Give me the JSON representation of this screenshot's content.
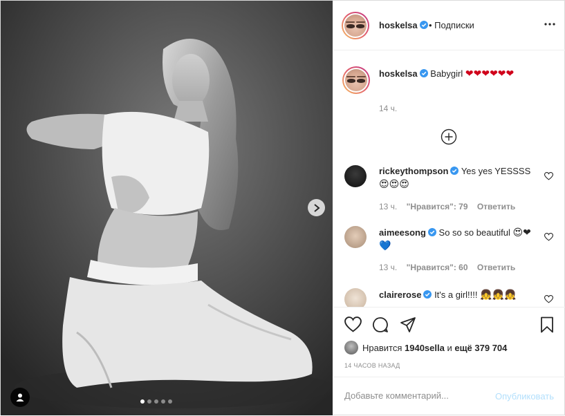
{
  "header": {
    "username": "hoskelsa",
    "follow_label": "• Подписки",
    "more_icon": "more-horizontal-icon"
  },
  "caption": {
    "username": "hoskelsa",
    "text": "Babygirl",
    "emojis": "❤❤❤❤❤❤",
    "time": "14 ч."
  },
  "comments": [
    {
      "username": "rickeythompson",
      "text": "Yes yes YESSSS",
      "emojis": "😍😍😍",
      "time": "13 ч.",
      "likes": "\"Нравится\": 79",
      "reply": "Ответить"
    },
    {
      "username": "aimeesong",
      "text": "So so so beautiful",
      "emojis": "😍❤💙",
      "time": "13 ч.",
      "likes": "\"Нравится\": 60",
      "reply": "Ответить"
    },
    {
      "username": "clairerose",
      "text": "It's a girl!!!!",
      "emojis": "👧👧👧"
    }
  ],
  "actions": {
    "liked_by_prefix": "Нравится",
    "liked_by_user": "1940sella",
    "liked_by_and": "и",
    "liked_by_others": "ещё 379 704",
    "timestamp": "14 ЧАСОВ НАЗАД"
  },
  "comment_box": {
    "placeholder": "Добавьте комментарий...",
    "publish_label": "Опубликовать"
  },
  "colors": {
    "accent_link": "#b2dffc",
    "verified": "#3897f0",
    "heart": "#d0021b",
    "muted_text": "#8e8e8e"
  }
}
